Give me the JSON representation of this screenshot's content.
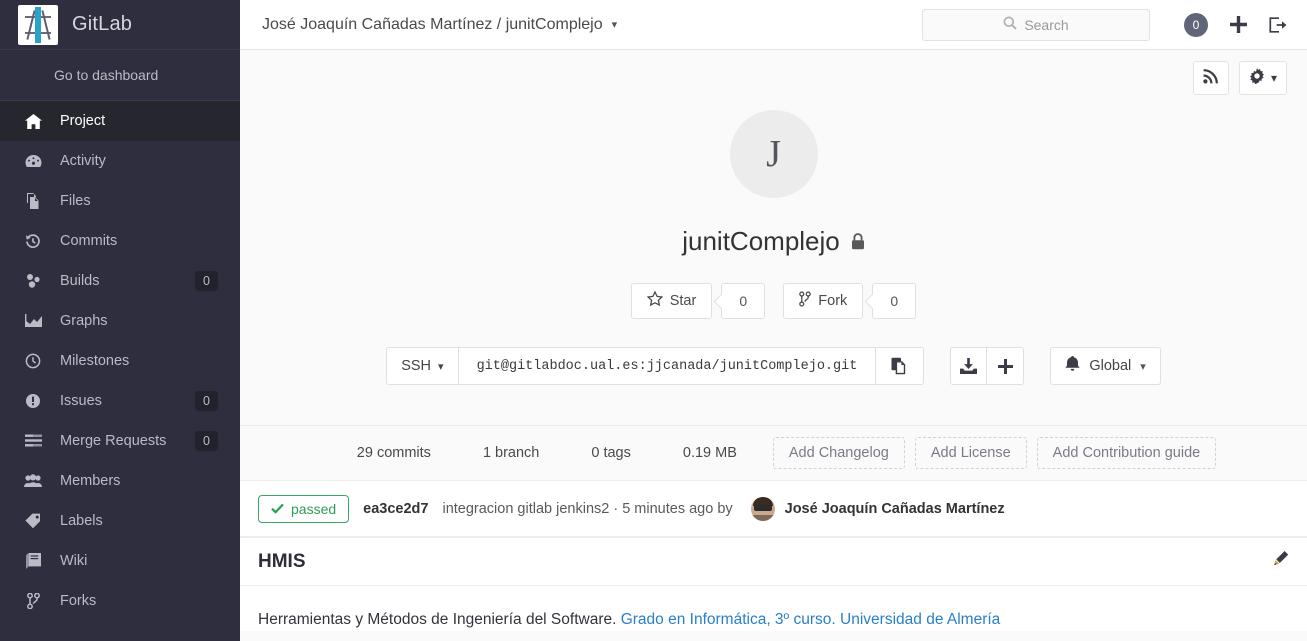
{
  "sidebar": {
    "brand": {
      "name": "GitLab",
      "logo_icon": "gitlab-logo-icon"
    },
    "dashboard_link": "Go to dashboard",
    "items": [
      {
        "label": "Project",
        "icon": "home-icon",
        "badge": "",
        "active": true
      },
      {
        "label": "Activity",
        "icon": "dashboard-icon",
        "badge": "",
        "active": false
      },
      {
        "label": "Files",
        "icon": "files-icon",
        "badge": "",
        "active": false
      },
      {
        "label": "Commits",
        "icon": "history-icon",
        "badge": "",
        "active": false
      },
      {
        "label": "Builds",
        "icon": "builds-icon",
        "badge": "0",
        "active": false
      },
      {
        "label": "Graphs",
        "icon": "graph-icon",
        "badge": "",
        "active": false
      },
      {
        "label": "Milestones",
        "icon": "clock-icon",
        "badge": "",
        "active": false
      },
      {
        "label": "Issues",
        "icon": "exclamation-icon",
        "badge": "0",
        "active": false
      },
      {
        "label": "Merge Requests",
        "icon": "merge-request-icon",
        "badge": "0",
        "active": false
      },
      {
        "label": "Members",
        "icon": "users-icon",
        "badge": "",
        "active": false
      },
      {
        "label": "Labels",
        "icon": "tag-icon",
        "badge": "",
        "active": false
      },
      {
        "label": "Wiki",
        "icon": "book-icon",
        "badge": "",
        "active": false
      },
      {
        "label": "Forks",
        "icon": "fork-icon",
        "badge": "",
        "active": false
      }
    ]
  },
  "topbar": {
    "breadcrumb": "José Joaquín Cañadas Martínez / junitComplejo",
    "breadcrumb_caret": "▾",
    "search_placeholder": "Search",
    "search_value": "",
    "todo_count": "0",
    "new_icon": "plus-icon",
    "signout_icon": "sign-out-icon"
  },
  "tools": {
    "rss_icon": "rss-feed-icon",
    "settings_icon": "gear-icon",
    "settings_caret": "▾"
  },
  "project": {
    "avatar_letter": "J",
    "name": "junitComplejo",
    "visibility_icon": "lock-icon",
    "star_label": "Star",
    "star_count": "0",
    "fork_label": "Fork",
    "fork_count": "0"
  },
  "clone": {
    "protocol": "SSH",
    "protocol_caret": "▾",
    "url": "git@gitlabdoc.ual.es:jjcanada/junitComplejo.git",
    "copy_icon": "copy-to-clipboard-icon",
    "download_icon": "download-icon",
    "add_icon": "plus-icon",
    "notification_label": "Global",
    "notification_icon": "bell-icon",
    "notification_caret": "▾"
  },
  "stats": {
    "commits": "29 commits",
    "branches": "1 branch",
    "tags": "0 tags",
    "size": "0.19 MB",
    "add_changelog": "Add Changelog",
    "add_license": "Add License",
    "add_contribution_guide": "Add Contribution guide"
  },
  "last_commit": {
    "status": "passed",
    "status_color": "#2e9e57",
    "sha": "ea3ce2d7",
    "message": "integracion gitlab jenkins2 · 5 minutes ago by",
    "author": "José Joaquín Cañadas Martínez"
  },
  "readme": {
    "title": "HMIS",
    "edit_icon": "pencil-icon",
    "text_plain": "Herramientas y Métodos de Ingeniería del Software. ",
    "link1": "Grado en Informática, 3º curso.",
    "space": " ",
    "link2": "Universidad de Almería",
    "link_color": "#2a7fc9"
  }
}
